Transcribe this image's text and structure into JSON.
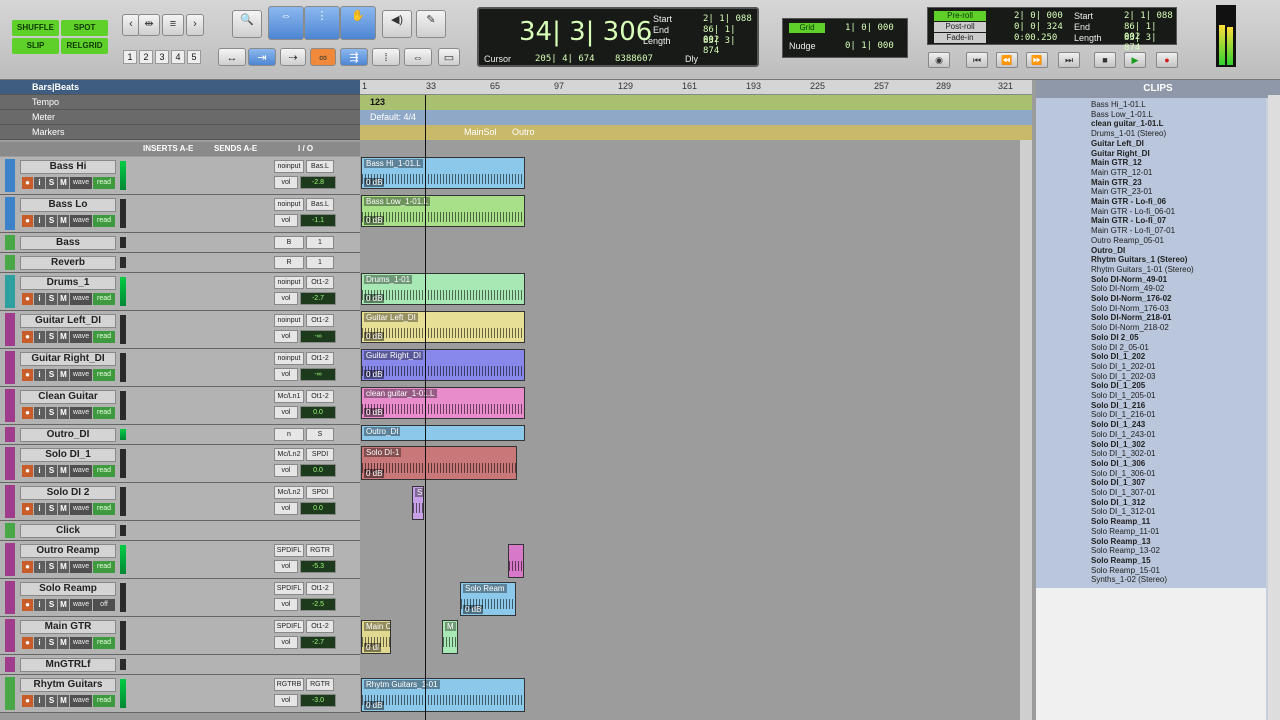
{
  "toolbar": {
    "modes": [
      "SHUFFLE",
      "SPOT",
      "SLIP",
      "GRID"
    ],
    "mode_active": "SLIP",
    "grid_mode_suffix": "RELGRID",
    "numbers": [
      "1",
      "2",
      "3",
      "4",
      "5"
    ],
    "main_counter": "34| 3| 306",
    "start_label": "Start",
    "start_val": "2| 1| 088",
    "end_label": "End",
    "end_val": "86| 1| 002",
    "length_label": "Length",
    "length_val": "83| 3| 874",
    "cursor_label": "Cursor",
    "cursor_val": "205| 4| 674",
    "cursor_samples": "8388607",
    "dly_label": "Dly",
    "grid_label": "Grid",
    "grid_val": "1| 0| 000",
    "nudge_label": "Nudge",
    "nudge_val": "0| 1| 000",
    "preroll_label": "Pre-roll",
    "preroll_val": "2| 0| 000",
    "postroll_label": "Post-roll",
    "postroll_val": "0| 0| 324",
    "fadein_label": "Fade-in",
    "fadein_val": "0:00.250",
    "r_start_label": "Start",
    "r_start_val": "2| 1| 088",
    "r_end_label": "End",
    "r_end_val": "86| 1| 002",
    "r_length_label": "Length",
    "r_length_val": "83| 3| 874"
  },
  "rulers": {
    "bars_beats": "Bars|Beats",
    "tempo": "Tempo",
    "meter": "Meter",
    "markers": "Markers",
    "tempo_value": "123",
    "meter_value": "Default: 4/4",
    "marker_main": "MainSol",
    "marker_outro": "Outro",
    "bar_numbers": [
      "1",
      "33",
      "65",
      "97",
      "129",
      "161",
      "193",
      "225",
      "257",
      "289",
      "321"
    ]
  },
  "columns": {
    "inserts": "INSERTS A-E",
    "sends": "SENDS A-E",
    "io": "I / O"
  },
  "tracks": [
    {
      "name": "Bass Hi",
      "color": "#3c82c8",
      "in": "noinput",
      "out": "Bas.L",
      "vol": "-2.8",
      "mode": "read"
    },
    {
      "name": "Bass Lo",
      "color": "#3c82c8",
      "in": "noinput",
      "out": "Bas.L",
      "vol": "-1.1",
      "mode": "read"
    },
    {
      "name": "Bass",
      "color": "#48a848",
      "in": "B",
      "out": "1",
      "vol": "",
      "mode": ""
    },
    {
      "name": "Reverb",
      "color": "#48a848",
      "in": "R",
      "out": "1",
      "vol": "",
      "mode": ""
    },
    {
      "name": "Drums_1",
      "color": "#2fa0a0",
      "in": "noinput",
      "out": "Ot1-2",
      "vol": "-2.7",
      "mode": "read"
    },
    {
      "name": "Guitar Left_DI",
      "color": "#a03c8c",
      "in": "noinput",
      "out": "Ot1-2",
      "vol": "-∞",
      "mode": "read"
    },
    {
      "name": "Guitar Right_DI",
      "color": "#a03c8c",
      "in": "noinput",
      "out": "Ot1-2",
      "vol": "-∞",
      "mode": "read"
    },
    {
      "name": "Clean Guitar",
      "color": "#a03c8c",
      "in": "Mc/Ln1",
      "out": "Ot1-2",
      "vol": "0.0",
      "mode": "read"
    },
    {
      "name": "Outro_DI",
      "color": "#a03c8c",
      "in": "n",
      "out": "S",
      "vol": "",
      "mode": ""
    },
    {
      "name": "Solo DI_1",
      "color": "#a03c8c",
      "in": "Mc/Ln2",
      "out": "SPDI",
      "vol": "0.0",
      "mode": "read"
    },
    {
      "name": "Solo DI 2",
      "color": "#a03c8c",
      "in": "Mc/Ln2",
      "out": "SPDI",
      "vol": "0.0",
      "mode": "read"
    },
    {
      "name": "Click",
      "color": "#48a848",
      "in": "",
      "out": "",
      "vol": "",
      "mode": ""
    },
    {
      "name": "Outro Reamp",
      "color": "#a03c8c",
      "in": "SPDIFL",
      "out": "RGTR",
      "vol": "-5.3",
      "mode": "read"
    },
    {
      "name": "Solo Reamp",
      "color": "#a03c8c",
      "in": "SPDIFL",
      "out": "Ot1-2",
      "vol": "-2.5",
      "mode": "off"
    },
    {
      "name": "Main GTR",
      "color": "#a03c8c",
      "in": "SPDIFL",
      "out": "Ot1-2",
      "vol": "-2.7",
      "mode": "read"
    },
    {
      "name": "MnGTRLf",
      "color": "#a03c8c",
      "in": "",
      "out": "",
      "vol": "",
      "mode": ""
    },
    {
      "name": "Rhytm Guitars",
      "color": "#48a848",
      "in": "RGTRB",
      "out": "RGTR",
      "vol": "-3.0",
      "mode": "read"
    }
  ],
  "clips_timeline": [
    {
      "name": "Bass Hi_1-01.L",
      "gain": "0 dB",
      "color": "#8cc8ea"
    },
    {
      "name": "Bass Low_1-01.L",
      "gain": "0 dB",
      "color": "#a8e08a"
    },
    {
      "name": "Drums_1-01",
      "gain": "0 dB",
      "color": "#a8e8b4"
    },
    {
      "name": "Guitar Left_DI",
      "gain": "0 dB",
      "color": "#e8df96"
    },
    {
      "name": "Guitar Right_DI",
      "gain": "0 dB",
      "color": "#8888ea"
    },
    {
      "name": "clean guitar_1-01.L",
      "gain": "0 dB",
      "color": "#e88ccc"
    },
    {
      "name": "Outro_DI",
      "gain": "",
      "color": "#8cc8ea"
    },
    {
      "name": "Solo DI-1",
      "gain": "0 dB",
      "color": "#c87878"
    },
    {
      "name": "S",
      "gain": "",
      "color": "#c8a0e8"
    },
    {
      "name": "",
      "gain": "",
      "color": "#d878c8"
    },
    {
      "name": "Solo Ream",
      "gain": "0 dB",
      "color": "#8cc8ea"
    },
    {
      "name": "Main C",
      "gain": "0 dl",
      "color": "#e0d890"
    },
    {
      "name": "M",
      "gain": "",
      "color": "#a8e8b4"
    },
    {
      "name": "Rhytm Guitars_1-01",
      "gain": "0 dB",
      "color": "#8cc8ea"
    }
  ],
  "clips_panel": {
    "title": "CLIPS",
    "items": [
      {
        "name": "Bass Hi_1-01.L",
        "bold": false
      },
      {
        "name": "Bass Low_1-01.L",
        "bold": false
      },
      {
        "name": "clean guitar_1-01.L",
        "bold": true
      },
      {
        "name": "Drums_1-01 (Stereo)",
        "bold": false
      },
      {
        "name": "Guitar Left_DI",
        "bold": true
      },
      {
        "name": "Guitar Right_DI",
        "bold": true
      },
      {
        "name": "Main GTR_12",
        "bold": true
      },
      {
        "name": "Main GTR_12-01",
        "bold": false
      },
      {
        "name": "Main GTR_23",
        "bold": true
      },
      {
        "name": "Main GTR_23-01",
        "bold": false
      },
      {
        "name": "Main GTR - Lo-fi_06",
        "bold": true
      },
      {
        "name": "Main GTR - Lo-fi_06-01",
        "bold": false
      },
      {
        "name": "Main GTR - Lo-fi_07",
        "bold": true
      },
      {
        "name": "Main GTR - Lo-fi_07-01",
        "bold": false
      },
      {
        "name": "Outro Reamp_05-01",
        "bold": false
      },
      {
        "name": "Outro_DI",
        "bold": true
      },
      {
        "name": "Rhytm Guitars_1 (Stereo)",
        "bold": true
      },
      {
        "name": "Rhytm Guitars_1-01 (Stereo)",
        "bold": false
      },
      {
        "name": "Solo DI-Norm_49-01",
        "bold": true
      },
      {
        "name": "Solo DI-Norm_49-02",
        "bold": false
      },
      {
        "name": "Solo DI-Norm_176-02",
        "bold": true
      },
      {
        "name": "Solo DI-Norm_176-03",
        "bold": false
      },
      {
        "name": "Solo DI-Norm_218-01",
        "bold": true
      },
      {
        "name": "Solo DI-Norm_218-02",
        "bold": false
      },
      {
        "name": "Solo DI 2_05",
        "bold": true
      },
      {
        "name": "Solo DI 2_05-01",
        "bold": false
      },
      {
        "name": "Solo DI_1_202",
        "bold": true
      },
      {
        "name": "Solo DI_1_202-01",
        "bold": false
      },
      {
        "name": "Solo DI_1_202-03",
        "bold": false
      },
      {
        "name": "Solo DI_1_205",
        "bold": true
      },
      {
        "name": "Solo DI_1_205-01",
        "bold": false
      },
      {
        "name": "Solo DI_1_216",
        "bold": true
      },
      {
        "name": "Solo DI_1_216-01",
        "bold": false
      },
      {
        "name": "Solo DI_1_243",
        "bold": true
      },
      {
        "name": "Solo DI_1_243-01",
        "bold": false
      },
      {
        "name": "Solo DI_1_302",
        "bold": true
      },
      {
        "name": "Solo DI_1_302-01",
        "bold": false
      },
      {
        "name": "Solo DI_1_306",
        "bold": true
      },
      {
        "name": "Solo DI_1_306-01",
        "bold": false
      },
      {
        "name": "Solo DI_1_307",
        "bold": true
      },
      {
        "name": "Solo DI_1_307-01",
        "bold": false
      },
      {
        "name": "Solo DI_1_312",
        "bold": true
      },
      {
        "name": "Solo DI_1_312-01",
        "bold": false
      },
      {
        "name": "Solo Reamp_11",
        "bold": true
      },
      {
        "name": "Solo Reamp_11-01",
        "bold": false
      },
      {
        "name": "Solo Reamp_13",
        "bold": true
      },
      {
        "name": "Solo Reamp_13-02",
        "bold": false
      },
      {
        "name": "Solo Reamp_15",
        "bold": true
      },
      {
        "name": "Solo Reamp_15-01",
        "bold": false
      },
      {
        "name": "Synths_1-02 (Stereo)",
        "bold": false
      }
    ]
  }
}
